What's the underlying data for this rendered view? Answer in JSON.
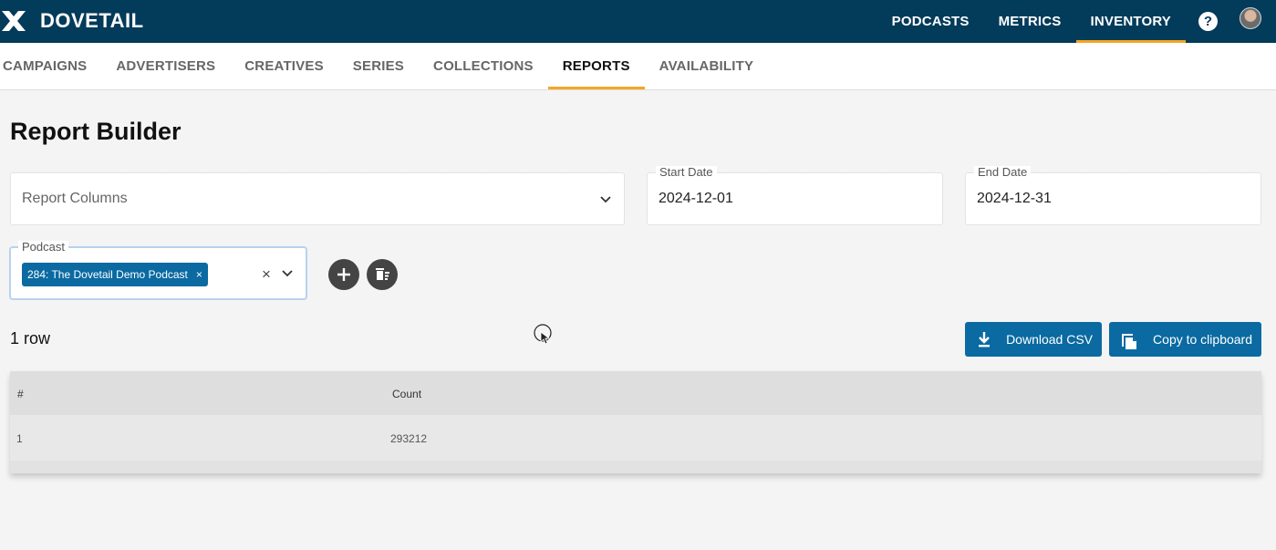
{
  "brand": {
    "name": "DOVETAIL"
  },
  "topnav": {
    "items": [
      {
        "label": "PODCASTS",
        "active": false
      },
      {
        "label": "METRICS",
        "active": false
      },
      {
        "label": "INVENTORY",
        "active": true
      }
    ],
    "help_label": "?"
  },
  "subnav": {
    "items": [
      {
        "label": "CAMPAIGNS",
        "active": false
      },
      {
        "label": "ADVERTISERS",
        "active": false
      },
      {
        "label": "CREATIVES",
        "active": false
      },
      {
        "label": "SERIES",
        "active": false
      },
      {
        "label": "COLLECTIONS",
        "active": false
      },
      {
        "label": "REPORTS",
        "active": true
      },
      {
        "label": "AVAILABILITY",
        "active": false
      }
    ]
  },
  "page": {
    "title": "Report Builder"
  },
  "form": {
    "report_columns_placeholder": "Report Columns",
    "start_date": {
      "label": "Start Date",
      "value": "2024-12-01"
    },
    "end_date": {
      "label": "End Date",
      "value": "2024-12-31"
    },
    "podcast": {
      "label": "Podcast",
      "chip": "284: The Dovetail Demo Podcast",
      "chip_remove": "×",
      "clear": "×"
    }
  },
  "results": {
    "row_count": "1 row",
    "download_label": "Download CSV",
    "copy_label": "Copy to clipboard",
    "table": {
      "headers": [
        "#",
        "Count"
      ],
      "rows": [
        [
          "1",
          "293212"
        ]
      ]
    }
  },
  "colors": {
    "topbar": "#033b5a",
    "accent": "#f5a623",
    "primary_button": "#0a6aa1"
  }
}
